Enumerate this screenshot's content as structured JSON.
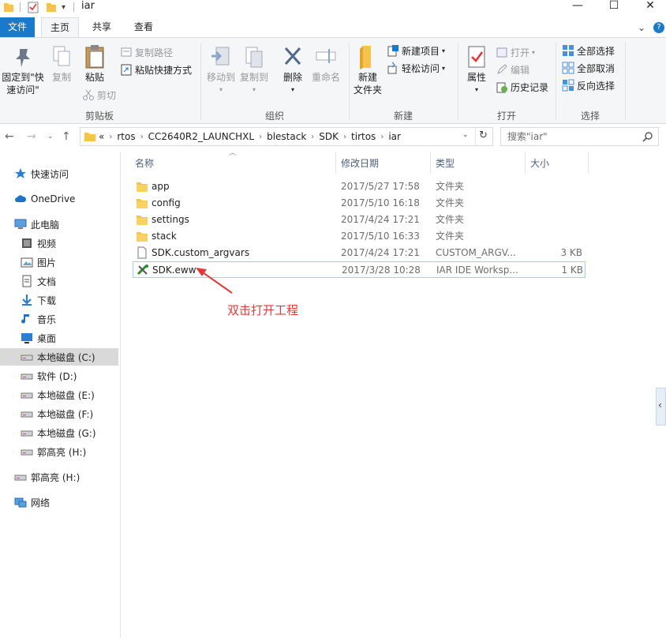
{
  "window": {
    "title": "iar",
    "minimize": "—",
    "maximize": "☐",
    "close": "✕"
  },
  "tabs": {
    "file": "文件",
    "home": "主页",
    "share": "共享",
    "view": "查看"
  },
  "ribbon": {
    "clipboard": {
      "pin_label": "固定到\"快\n速访问\"",
      "pin_line1": "固定到\"快",
      "pin_line2": "速访问\"",
      "copy_label": "复制",
      "paste_label": "粘贴",
      "copy_path": "复制路径",
      "paste_shortcut": "粘贴快捷方式",
      "cut": "剪切",
      "group_label": "剪贴板"
    },
    "organize": {
      "move_to": "移动到",
      "copy_to": "复制到",
      "delete": "删除",
      "rename": "重命名",
      "group_label": "组织"
    },
    "new": {
      "new_folder_line1": "新建",
      "new_folder_line2": "文件夹",
      "new_item": "新建项目",
      "easy_access": "轻松访问",
      "group_label": "新建"
    },
    "open": {
      "properties": "属性",
      "open": "打开",
      "edit": "编辑",
      "history": "历史记录",
      "group_label": "打开"
    },
    "select": {
      "select_all": "全部选择",
      "select_none": "全部取消",
      "invert": "反向选择",
      "group_label": "选择"
    }
  },
  "address": {
    "crumbs": [
      "rtos",
      "CC2640R2_LAUNCHXL",
      "blestack",
      "SDK",
      "tirtos",
      "iar"
    ],
    "overflow": "«",
    "search_placeholder": "搜索\"iar\""
  },
  "nav": {
    "items": [
      {
        "label": "快速访问"
      },
      {
        "label": "OneDrive"
      },
      {
        "label": "此电脑"
      },
      {
        "label": "视频"
      },
      {
        "label": "图片"
      },
      {
        "label": "文档"
      },
      {
        "label": "下载"
      },
      {
        "label": "音乐"
      },
      {
        "label": "桌面"
      },
      {
        "label": "本地磁盘 (C:)"
      },
      {
        "label": "软件 (D:)"
      },
      {
        "label": "本地磁盘 (E:)"
      },
      {
        "label": "本地磁盘 (F:)"
      },
      {
        "label": "本地磁盘 (G:)"
      },
      {
        "label": "郭高亮 (H:)"
      },
      {
        "label": "郭高亮 (H:)"
      },
      {
        "label": "网络"
      }
    ]
  },
  "columns": {
    "name": "名称",
    "date": "修改日期",
    "type": "类型",
    "size": "大小"
  },
  "files": [
    {
      "name": "app",
      "date": "2017/5/27 17:58",
      "type": "文件夹",
      "size": ""
    },
    {
      "name": "config",
      "date": "2017/5/10 16:18",
      "type": "文件夹",
      "size": ""
    },
    {
      "name": "settings",
      "date": "2017/4/24 17:21",
      "type": "文件夹",
      "size": ""
    },
    {
      "name": "stack",
      "date": "2017/5/10 16:33",
      "type": "文件夹",
      "size": ""
    },
    {
      "name": "SDK.custom_argvars",
      "date": "2017/4/24 17:21",
      "type": "CUSTOM_ARGV...",
      "size": "3 KB"
    },
    {
      "name": "SDK.eww",
      "date": "2017/3/28 10:28",
      "type": "IAR IDE Worksp...",
      "size": "1 KB"
    }
  ],
  "annotation": {
    "text": "双击打开工程",
    "color": "#e03a3a"
  },
  "colors": {
    "file_tab": "#1979ca",
    "ribbon_bg": "#f5f6f7",
    "folder": "#f8c24c",
    "selection_border": "#99d1ff"
  }
}
